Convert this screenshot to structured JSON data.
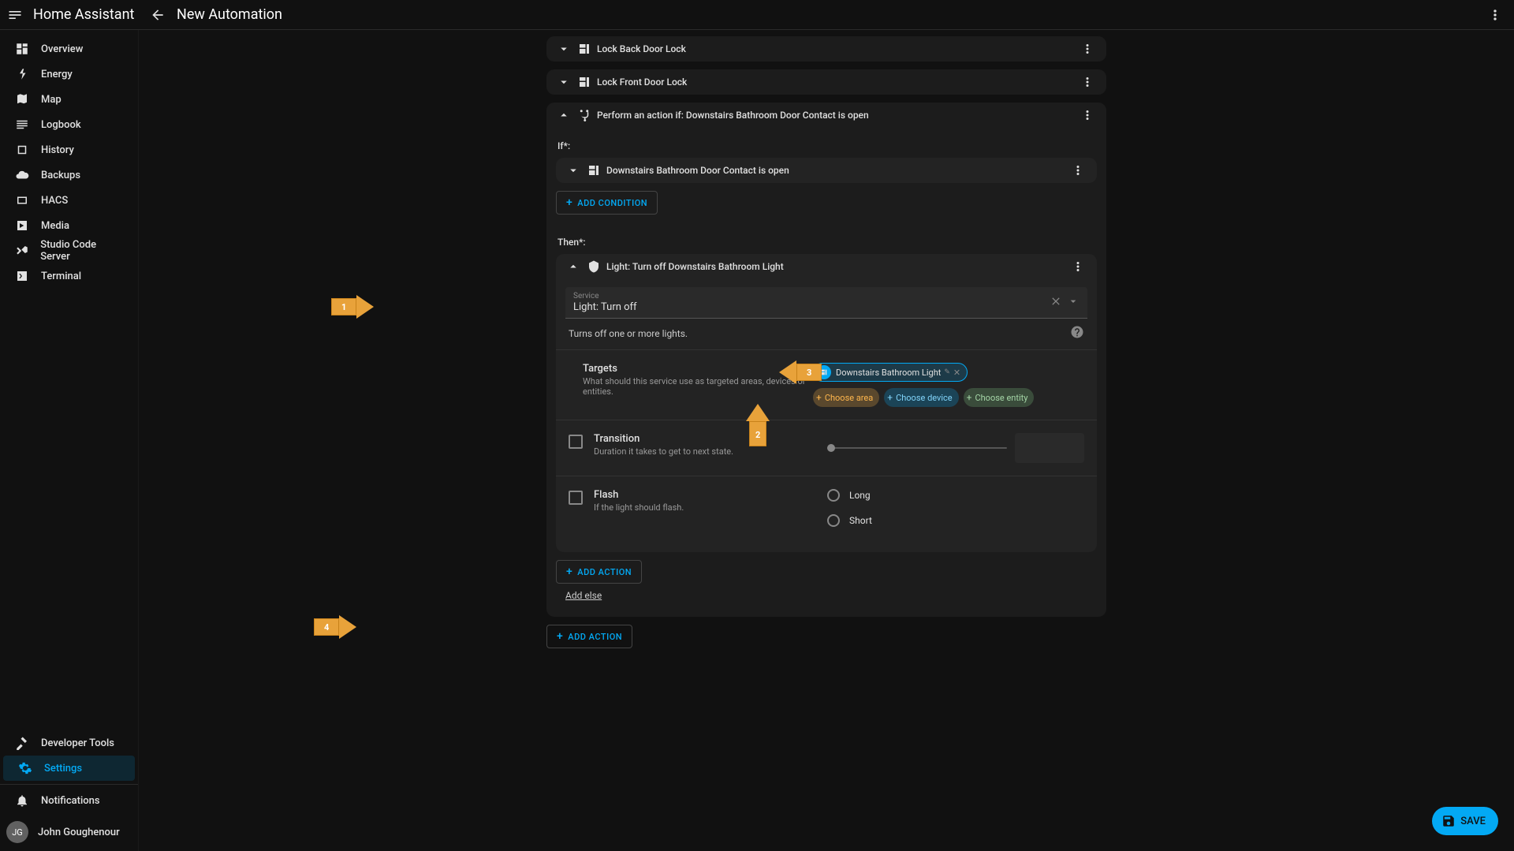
{
  "app_title": "Home Assistant",
  "page_title": "New Automation",
  "sidebar": {
    "items": [
      {
        "label": "Overview"
      },
      {
        "label": "Energy"
      },
      {
        "label": "Map"
      },
      {
        "label": "Logbook"
      },
      {
        "label": "History"
      },
      {
        "label": "Backups"
      },
      {
        "label": "HACS"
      },
      {
        "label": "Media"
      },
      {
        "label": "Studio Code Server"
      },
      {
        "label": "Terminal"
      }
    ],
    "dev_tools": "Developer Tools",
    "settings": "Settings",
    "notifications": "Notifications"
  },
  "user": {
    "initials": "JG",
    "name": "John Goughenour"
  },
  "cards": {
    "lock_back": "Lock Back Door Lock",
    "lock_front": "Lock Front Door Lock",
    "if_card": "Perform an action if: Downstairs Bathroom Door Contact is open",
    "if_label": "If*:",
    "condition": "Downstairs Bathroom Door Contact is open",
    "add_condition": "ADD CONDITION",
    "then_label": "Then*:",
    "light_action": "Light: Turn off Downstairs Bathroom Light",
    "service_label": "Service",
    "service_value": "Light: Turn off",
    "service_desc": "Turns off one or more lights.",
    "targets_title": "Targets",
    "targets_sub": "What should this service use as targeted areas, devices or entities.",
    "selected_device": "Downstairs Bathroom Light",
    "choose_area": "Choose area",
    "choose_device": "Choose device",
    "choose_entity": "Choose entity",
    "transition_title": "Transition",
    "transition_sub": "Duration it takes to get to next state.",
    "flash_title": "Flash",
    "flash_sub": "If the light should flash.",
    "flash_long": "Long",
    "flash_short": "Short",
    "add_action": "ADD ACTION",
    "add_else": "Add else"
  },
  "bottom_add_action": "ADD ACTION",
  "save": "SAVE",
  "arrows": {
    "a1": "1",
    "a2": "2",
    "a3": "3",
    "a4": "4"
  }
}
